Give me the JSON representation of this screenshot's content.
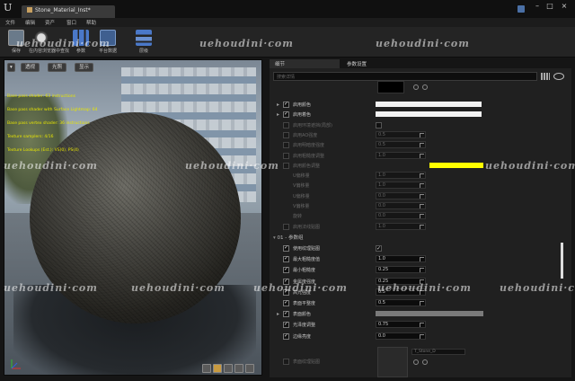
{
  "titlebar": {
    "tab_label": "Stone_Material_Inst*",
    "help_icon": "help-icon"
  },
  "menu": [
    "文件",
    "编辑",
    "资产",
    "窗口",
    "帮助"
  ],
  "toolbar": [
    {
      "label": "保存",
      "icon": "save-icon"
    },
    {
      "label": "在内容浏览器中查找",
      "icon": "find-icon"
    },
    {
      "label": "参数",
      "icon": "params-icon"
    },
    {
      "label": "平台数据",
      "icon": "platform-icon"
    },
    {
      "label": "层级",
      "icon": "hierarchy-icon"
    }
  ],
  "viewport": {
    "btn_perspective": "透视",
    "btn_lit": "光照",
    "btn_show": "显示",
    "stats_lines": [
      "Base pass shader: 63 instructions",
      "Base pass shader with Surface Lightmap: 64",
      "Base pass vertex shader: 36 instructions",
      "Texture samplers: 4/16",
      "Texture Lookups (Est.): VS(0), PS(4)"
    ]
  },
  "details": {
    "tabs": [
      "细节",
      "参数设置"
    ],
    "search_placeholder": "搜索详情",
    "properties": [
      {
        "name": "启用颜色",
        "checked": true,
        "expander": true,
        "kind": "bar",
        "fill": 0.98
      },
      {
        "name": "启用着色",
        "checked": true,
        "expander": true,
        "kind": "bar",
        "fill": 0.98
      },
      {
        "name": "启用环境遮挡(局部)",
        "checked": false,
        "kind": "swatch"
      },
      {
        "name": "启用AO强度",
        "checked": false,
        "kind": "num",
        "value": "0.5"
      },
      {
        "name": "启用明暗度强度",
        "checked": false,
        "kind": "num",
        "value": "0.5"
      },
      {
        "name": "启用粗糙度调整",
        "checked": false,
        "kind": "num",
        "value": "1.0"
      },
      {
        "name": "启用颜色调整",
        "checked": false,
        "kind": "yellow"
      },
      {
        "name": "U偏移量",
        "checked": false,
        "kind": "num",
        "value": "1.0",
        "nochk": true
      },
      {
        "name": "V偏移量",
        "checked": false,
        "kind": "num",
        "value": "1.0",
        "nochk": true
      },
      {
        "name": "U偏移量",
        "checked": false,
        "kind": "num",
        "value": "0.0",
        "nochk": true
      },
      {
        "name": "V偏移量",
        "checked": false,
        "kind": "num",
        "value": "0.0",
        "nochk": true
      },
      {
        "name": "旋转",
        "checked": false,
        "kind": "num",
        "value": "0.0",
        "nochk": true
      },
      {
        "name": "启用法线贴图",
        "checked": false,
        "kind": "num",
        "value": "1.0"
      }
    ],
    "section_label": "01 - 参数组",
    "section_props": [
      {
        "name": "使用纹理贴图",
        "checked": true,
        "kind": "check",
        "value": ""
      },
      {
        "name": "最大粗糙度值",
        "checked": true,
        "kind": "num",
        "value": "1.0"
      },
      {
        "name": "最小粗糙度",
        "checked": true,
        "kind": "num",
        "value": "0.25"
      },
      {
        "name": "金属度强度",
        "checked": true,
        "kind": "num",
        "value": "0.25"
      },
      {
        "name": "高光强度",
        "checked": true,
        "kind": "num",
        "value": "0.5"
      },
      {
        "name": "表面平整度",
        "checked": true,
        "kind": "num",
        "value": "0.5"
      },
      {
        "name": "表面颜色",
        "checked": true,
        "kind": "gray",
        "expander": true
      },
      {
        "name": "光泽度调整",
        "checked": true,
        "kind": "num",
        "value": "0.75"
      },
      {
        "name": "边缘亮度",
        "checked": true,
        "kind": "num",
        "value": "0.0"
      }
    ],
    "texture_label": "表面纹理贴图",
    "texture_name": "T_Stone_D"
  },
  "watermark_text": "uehoudini·com",
  "colors": {
    "yellow_bar": "#ffff00",
    "accent": "#c89a40"
  }
}
